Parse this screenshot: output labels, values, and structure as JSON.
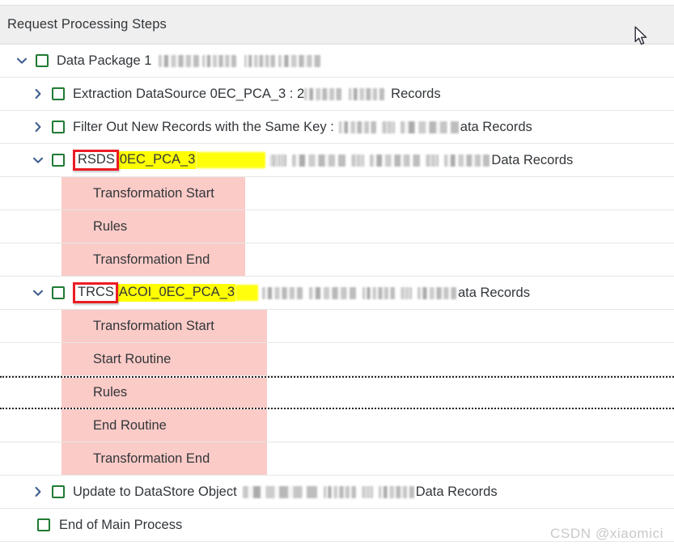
{
  "header": {
    "title": "Request Processing Steps"
  },
  "icons": {
    "chevron_down": "chevron-down-icon",
    "chevron_right": "chevron-right-icon",
    "checkbox": "checkbox-icon"
  },
  "colors": {
    "checkbox_green": "#1f7a33",
    "highlight_yellow": "#ffff00",
    "annotation_red": "#ec1c24",
    "group_pink": "#fbcbc7",
    "header_bg": "#efefef",
    "text": "#32363a",
    "chevron_blue": "#3f5f8f"
  },
  "tree": {
    "rows": [
      {
        "id": "data-package-1",
        "expander": "chevron-down-icon",
        "label": "Data Package 1",
        "redacted_after": true,
        "suffix": ""
      },
      {
        "id": "extraction-datasource",
        "expander": "chevron-right-icon",
        "label": "Extraction DataSource 0EC_PCA_3 : 2",
        "redacted_after": true,
        "suffix": "Records"
      },
      {
        "id": "filter-out-new-records",
        "expander": "chevron-right-icon",
        "label": "Filter Out New Records with the Same Key :",
        "redacted_after": true,
        "suffix": "ata Records"
      },
      {
        "id": "rsds-transformation",
        "expander": "chevron-down-icon",
        "boxed_prefix": "RSDS",
        "highlight": "0EC_PCA_3",
        "redacted_after": true,
        "suffix": "Data Records"
      },
      {
        "id": "rsds-transformation-start",
        "expander": null,
        "label": "Transformation Start",
        "group": "rsds"
      },
      {
        "id": "rsds-rules",
        "expander": null,
        "label": "Rules",
        "group": "rsds"
      },
      {
        "id": "rsds-transformation-end",
        "expander": null,
        "label": "Transformation End",
        "group": "rsds"
      },
      {
        "id": "trcs-transformation",
        "expander": "chevron-down-icon",
        "boxed_prefix": "TRCS",
        "highlight": "ACOI_0EC_PCA_3",
        "redacted_after": true,
        "suffix": "ata Records"
      },
      {
        "id": "trcs-transformation-start",
        "expander": null,
        "label": "Transformation Start",
        "group": "trcs"
      },
      {
        "id": "trcs-start-routine",
        "expander": null,
        "label": "Start Routine",
        "group": "trcs"
      },
      {
        "id": "trcs-rules",
        "expander": null,
        "label": "Rules",
        "group": "trcs"
      },
      {
        "id": "trcs-end-routine",
        "expander": null,
        "label": "End Routine",
        "group": "trcs"
      },
      {
        "id": "trcs-transformation-end",
        "expander": null,
        "label": "Transformation End",
        "group": "trcs"
      },
      {
        "id": "update-to-datastore-object",
        "expander": "chevron-right-icon",
        "label": "Update to DataStore Object",
        "redacted_after": true,
        "suffix": "Data Records"
      },
      {
        "id": "end-of-main-process",
        "expander": null,
        "label": "End of Main Process"
      }
    ]
  },
  "watermark": {
    "text": "CSDN @xiaomici"
  }
}
